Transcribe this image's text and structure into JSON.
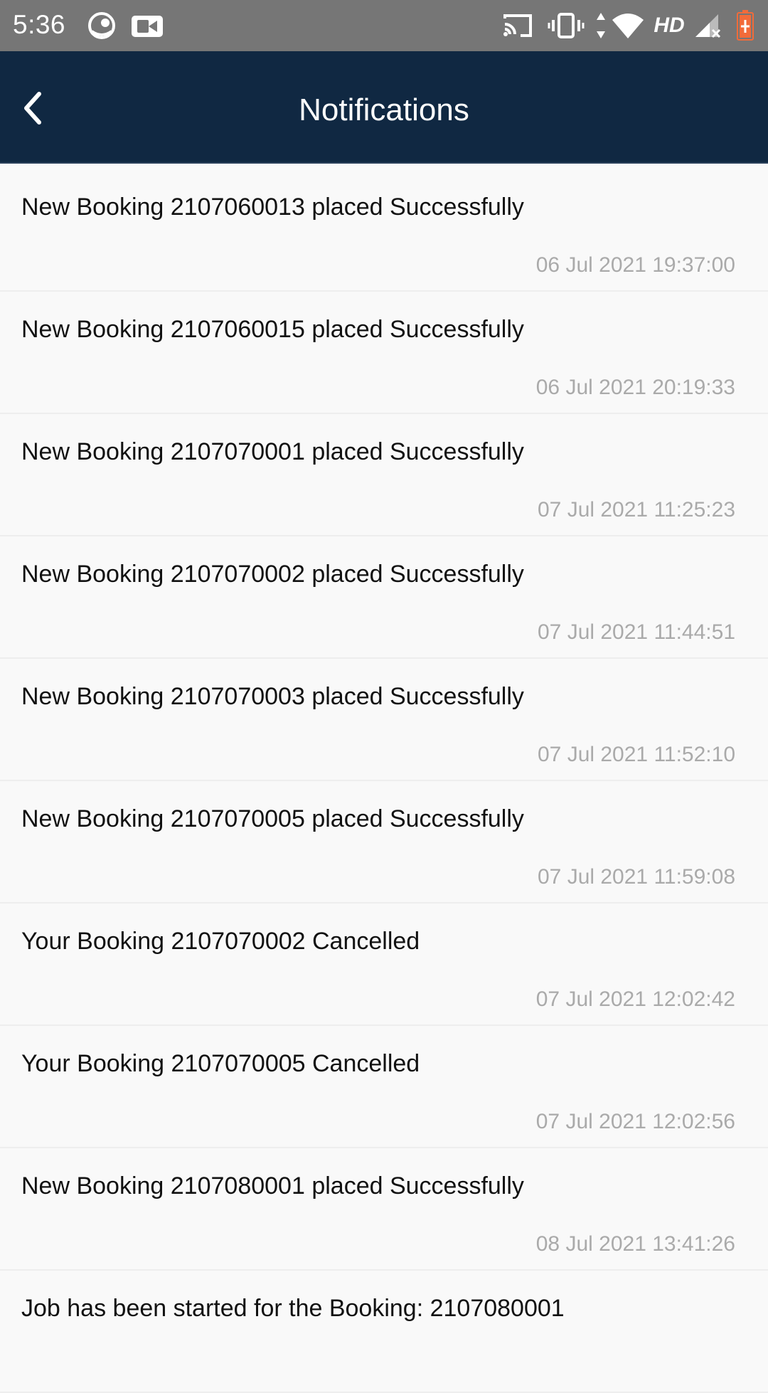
{
  "status_bar": {
    "time": "5:36",
    "hd_label": "HD",
    "icons": [
      "assistant-icon",
      "video-camera-icon",
      "cast-icon",
      "vibrate-icon",
      "data-arrows-icon",
      "wifi-icon",
      "signal-icon",
      "battery-charging-icon"
    ]
  },
  "header": {
    "title": "Notifications",
    "back_icon": "chevron-left-icon"
  },
  "colors": {
    "header_bg": "#102842",
    "status_bar_bg": "#767676",
    "list_bg": "#f9f9f9",
    "timestamp": "#aaaaaa",
    "battery_accent": "#f26b3a"
  },
  "notifications": [
    {
      "message": "New Booking 2107060013 placed Successfully",
      "time": "06 Jul 2021 19:37:00"
    },
    {
      "message": "New Booking 2107060015 placed Successfully",
      "time": "06 Jul 2021 20:19:33"
    },
    {
      "message": "New Booking 2107070001 placed Successfully",
      "time": "07 Jul 2021 11:25:23"
    },
    {
      "message": "New Booking 2107070002 placed Successfully",
      "time": "07 Jul 2021 11:44:51"
    },
    {
      "message": "New Booking 2107070003 placed Successfully",
      "time": "07 Jul 2021 11:52:10"
    },
    {
      "message": "New Booking 2107070005 placed Successfully",
      "time": "07 Jul 2021 11:59:08"
    },
    {
      "message": "Your Booking 2107070002 Cancelled",
      "time": "07 Jul 2021 12:02:42"
    },
    {
      "message": "Your Booking 2107070005 Cancelled",
      "time": "07 Jul 2021 12:02:56"
    },
    {
      "message": "New Booking 2107080001 placed Successfully",
      "time": "08 Jul 2021 13:41:26"
    },
    {
      "message": "Job has been started for the Booking: 2107080001",
      "time": ""
    }
  ]
}
